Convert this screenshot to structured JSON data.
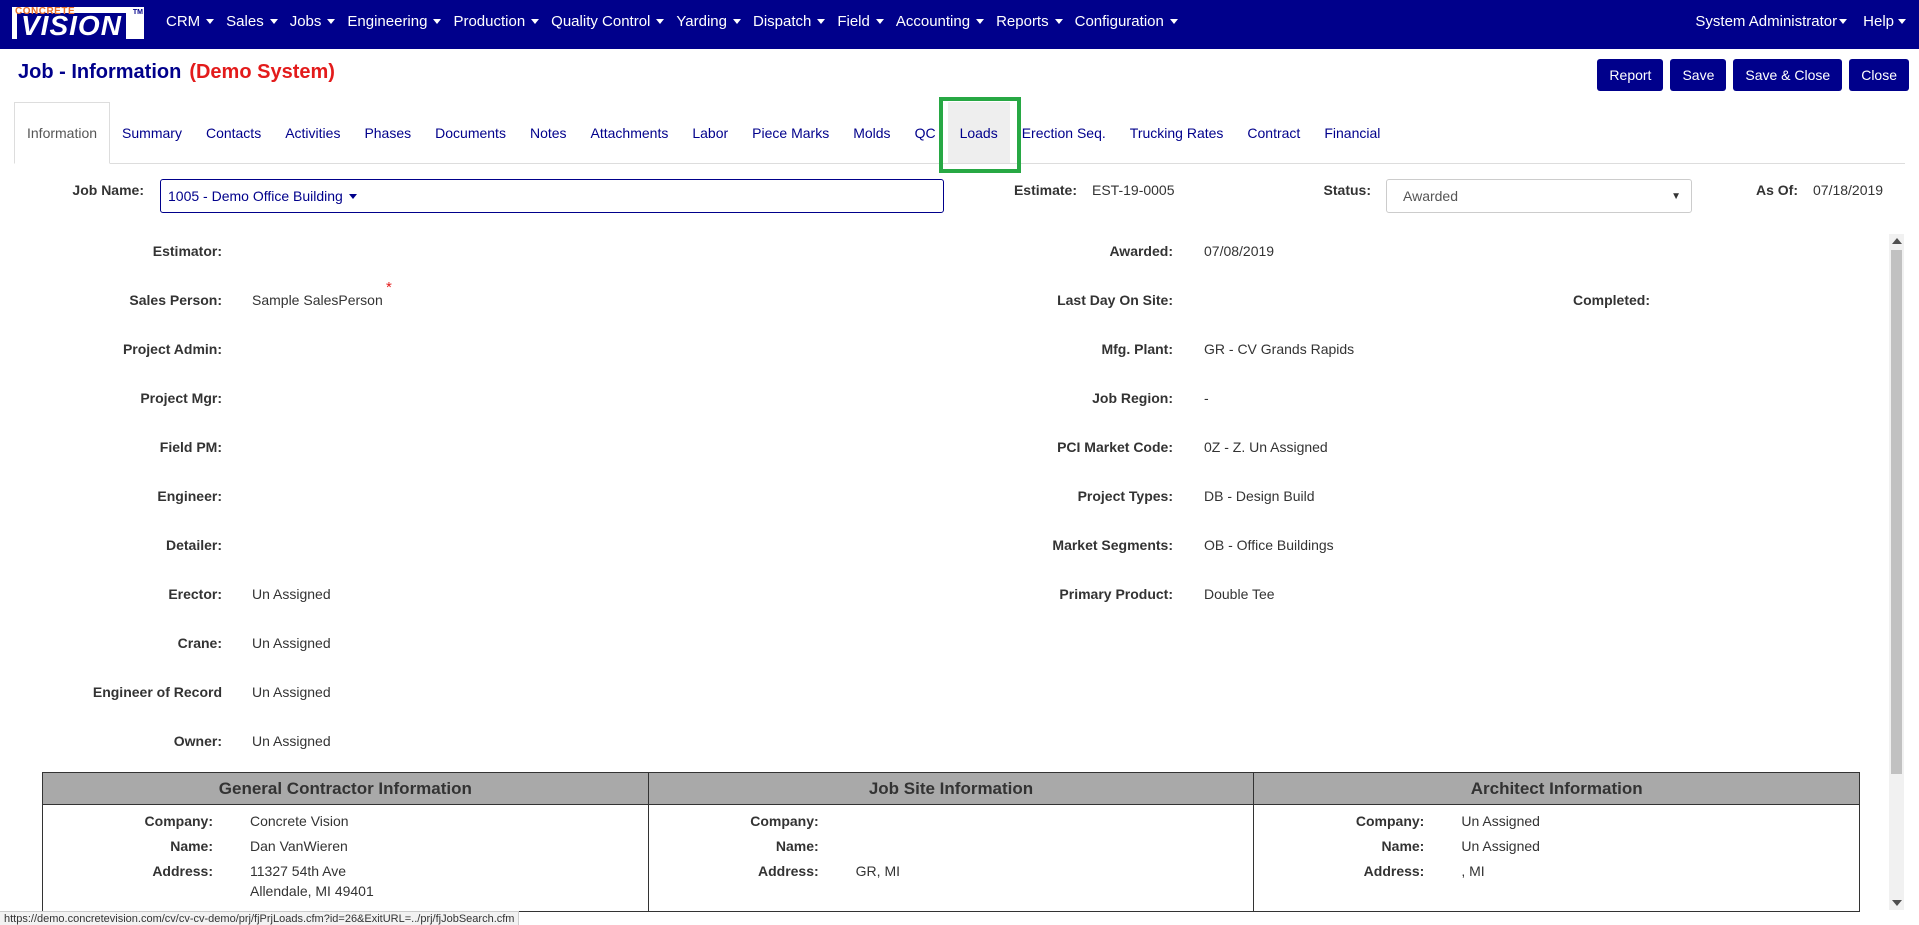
{
  "brand": {
    "small": "CONCRETE",
    "big": "VISION",
    "tm": "TM"
  },
  "nav": {
    "items": [
      "CRM",
      "Sales",
      "Jobs",
      "Engineering",
      "Production",
      "Quality Control",
      "Yarding",
      "Dispatch",
      "Field",
      "Accounting",
      "Reports",
      "Configuration"
    ],
    "user": "System Administrator",
    "help": "Help"
  },
  "header": {
    "title": "Job - Information",
    "demo": "(Demo System)",
    "buttons": {
      "report": "Report",
      "save": "Save",
      "save_close": "Save & Close",
      "close": "Close"
    }
  },
  "tabs": [
    "Information",
    "Summary",
    "Contacts",
    "Activities",
    "Phases",
    "Documents",
    "Notes",
    "Attachments",
    "Labor",
    "Piece Marks",
    "Molds",
    "QC",
    "Loads",
    "Erection Seq.",
    "Trucking Rates",
    "Contract",
    "Financial"
  ],
  "top": {
    "job_name_label": "Job Name:",
    "job_name_value": "1005 - Demo Office Building",
    "estimate_label": "Estimate:",
    "estimate_value": "EST-19-0005",
    "status_label": "Status:",
    "status_value": "Awarded",
    "asof_label": "As Of:",
    "asof_value": "07/18/2019"
  },
  "left_fields": [
    {
      "label": "Estimator:",
      "value": ""
    },
    {
      "label": "Sales Person:",
      "value": "Sample SalesPerson"
    },
    {
      "label": "Project Admin:",
      "value": ""
    },
    {
      "label": "Project Mgr:",
      "value": ""
    },
    {
      "label": "Field PM:",
      "value": ""
    },
    {
      "label": "Engineer:",
      "value": ""
    },
    {
      "label": "Detailer:",
      "value": ""
    },
    {
      "label": "Erector:",
      "value": "Un Assigned"
    },
    {
      "label": "Crane:",
      "value": "Un Assigned"
    },
    {
      "label": "Engineer of Record",
      "value": "Un Assigned"
    },
    {
      "label": "Owner:",
      "value": "Un Assigned"
    }
  ],
  "required_mark": "*",
  "right_fields": [
    {
      "label": "Awarded:",
      "value": "07/08/2019"
    },
    {
      "label": "Last Day On Site:",
      "value": ""
    },
    {
      "label": "Mfg. Plant:",
      "value": "GR - CV Grands Rapids"
    },
    {
      "label": "Job Region:",
      "value": "-"
    },
    {
      "label": "PCI Market Code:",
      "value": "0Z - Z. Un Assigned"
    },
    {
      "label": "Project Types:",
      "value": "DB - Design Build"
    },
    {
      "label": "Market Segments:",
      "value": "OB - Office Buildings"
    },
    {
      "label": "Primary Product:",
      "value": "Double Tee"
    }
  ],
  "completed_label": "Completed:",
  "info_boxes": [
    {
      "title": "General Contractor Information",
      "rows": [
        {
          "label": "Company:",
          "value": "Concrete Vision"
        },
        {
          "label": "Name:",
          "value": "Dan VanWieren"
        },
        {
          "label": "Address:",
          "value": "11327 54th Ave",
          "value2": "Allendale, MI 49401"
        }
      ]
    },
    {
      "title": "Job Site Information",
      "rows": [
        {
          "label": "Company:",
          "value": ""
        },
        {
          "label": "Name:",
          "value": ""
        },
        {
          "label": "Address:",
          "value": "GR, MI",
          "value2": ""
        }
      ]
    },
    {
      "title": "Architect Information",
      "rows": [
        {
          "label": "Company:",
          "value": "Un Assigned"
        },
        {
          "label": "Name:",
          "value": "Un Assigned"
        },
        {
          "label": "Address:",
          "value": ", MI",
          "value2": ""
        }
      ]
    }
  ],
  "status_url": "https://demo.concretevision.com/cv/cv-cv-demo/prj/fjPrjLoads.cfm?id=26&ExitURL=../prj/fjJobSearch.cfm"
}
